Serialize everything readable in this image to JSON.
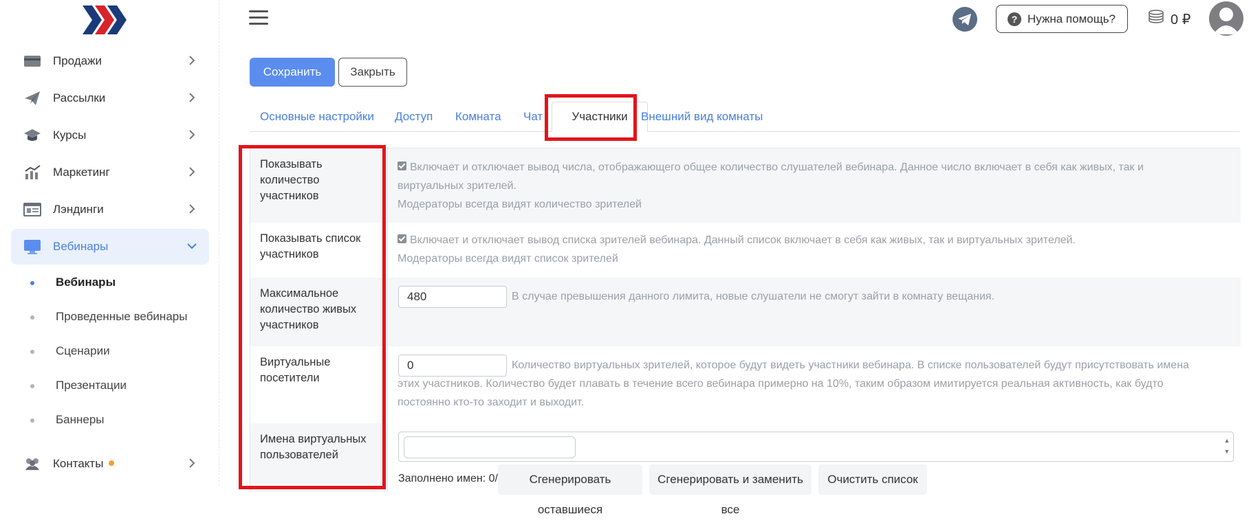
{
  "sidebar": {
    "items": [
      {
        "label": "Продажи",
        "icon": "card-icon"
      },
      {
        "label": "Рассылки",
        "icon": "paper-plane-icon"
      },
      {
        "label": "Курсы",
        "icon": "graduation-cap-icon"
      },
      {
        "label": "Маркетинг",
        "icon": "chart-icon"
      },
      {
        "label": "Лэндинги",
        "icon": "landing-icon"
      },
      {
        "label": "Вебинары",
        "icon": "monitor-icon",
        "active": true
      },
      {
        "label": "Контакты",
        "icon": "users-icon"
      }
    ],
    "sub_items": [
      {
        "label": "Вебинары",
        "active": true
      },
      {
        "label": "Проведенные вебинары"
      },
      {
        "label": "Сценарии"
      },
      {
        "label": "Презентации"
      },
      {
        "label": "Баннеры"
      }
    ]
  },
  "header": {
    "help_label": "Нужна помощь?",
    "help_icon_glyph": "?",
    "balance": "0 ₽"
  },
  "toolbar": {
    "save_label": "Сохранить",
    "close_label": "Закрыть"
  },
  "tabs": [
    {
      "label": "Основные настройки"
    },
    {
      "label": "Доступ"
    },
    {
      "label": "Комната"
    },
    {
      "label": "Чат"
    },
    {
      "label": "Участники",
      "active": true
    },
    {
      "label": "Внешний вид комнаты"
    }
  ],
  "settings": {
    "show_count": {
      "label": "Показывать количество участников",
      "checked": true,
      "desc1": "Включает и отключает вывод числа, отображающего общее количество слушателей вебинара. Данное число включает в себя как живых, так и",
      "desc2": "виртуальных зрителей.",
      "desc3": "Модераторы всегда видят количество зрителей"
    },
    "show_list": {
      "label": "Показывать список участников",
      "checked": true,
      "desc1": "Включает и отключает вывод списка зрителей вебинара. Данный список включает в себя как живых, так и виртуальных зрителей.",
      "desc2": "Модераторы всегда видят список зрителей"
    },
    "max_live": {
      "label": "Максимальное количество живых участников",
      "value": "480",
      "desc": "В случае превышения данного лимита, новые слушатели не смогут зайти в комнату вещания."
    },
    "virtual": {
      "label": "Виртуальные посетители",
      "value": "0",
      "desc1": "Количество виртуальных зрителей, которое будут видеть участники вебинара. В списке пользователей будут присутствовать имена",
      "desc2": "этих участников. Количество будет плавать в течение всего вебинара примерно на 10%, таким образом имитируется реальная активность, как будто",
      "desc3": "постоянно кто-то заходит и выходит."
    },
    "names": {
      "label": "Имена виртуальных пользователей",
      "filled": "Заполнено имен: 0/0",
      "gen_rest": "Сгенерировать оставшиеся",
      "gen_replace": "Сгенерировать и заменить все",
      "clear": "Очистить список"
    }
  },
  "colors": {
    "accent": "#4a7fe0",
    "save_button": "#5b8def",
    "highlight_box": "#e3141b",
    "brand_dark": "#1b3a7a",
    "brand_red": "#d8232a"
  }
}
